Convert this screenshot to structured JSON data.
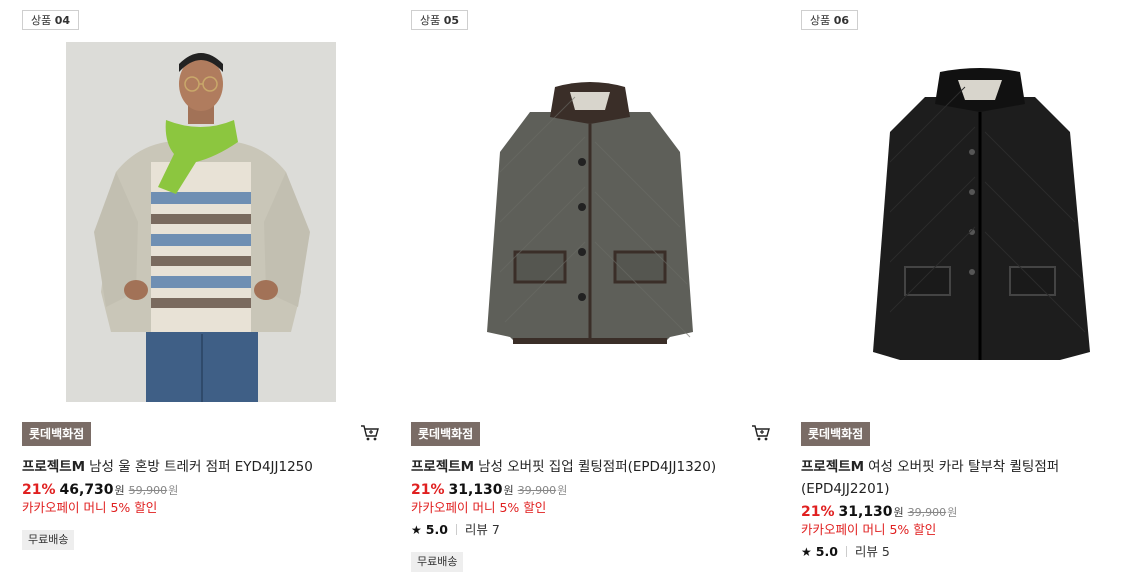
{
  "products": [
    {
      "tag_prefix": "상품",
      "tag_num": "04",
      "image": "model-wearing-wool-trucker-jumper",
      "store": "롯데백화점",
      "brand": "프로젝트M",
      "name": "남성 울 혼방 트레커 점퍼 EYD4JJ1250",
      "discount": "21%",
      "price": "46,730",
      "won": "원",
      "original_price": "59,900",
      "promo": "카카오페이 머니 5% 할인",
      "free_shipping": "무료배송"
    },
    {
      "tag_prefix": "상품",
      "tag_num": "05",
      "image": "grey-quilted-jacket",
      "store": "롯데백화점",
      "brand": "프로젝트M",
      "name": "남성 오버핏 집업 퀼팅점퍼(EPD4JJ1320)",
      "discount": "21%",
      "price": "31,130",
      "won": "원",
      "original_price": "39,900",
      "promo": "카카오페이 머니 5% 할인",
      "rating": "5.0",
      "reviews": "리뷰 7",
      "free_shipping": "무료배송"
    },
    {
      "tag_prefix": "상품",
      "tag_num": "06",
      "image": "black-quilted-jacket",
      "store": "롯데백화점",
      "brand": "프로젝트M",
      "name": "여성 오버핏 카라 탈부착 퀼팅점퍼 (EPD4JJ2201)",
      "discount": "21%",
      "price": "31,130",
      "won": "원",
      "original_price": "39,900",
      "promo": "카카오페이 머니 5% 할인",
      "rating": "5.0",
      "reviews": "리뷰 5"
    }
  ],
  "colors": {
    "accent_red": "#e02020",
    "store_badge": "#7a6c66"
  }
}
